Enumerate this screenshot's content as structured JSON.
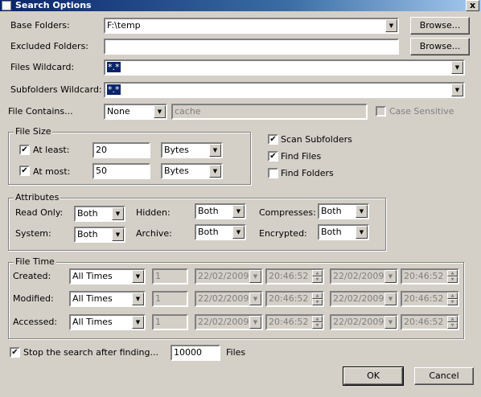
{
  "window": {
    "title": "Search Options",
    "close_glyph": "x"
  },
  "base_folders": {
    "label": "Base Folders:",
    "value": "F:\\temp",
    "browse": "Browse..."
  },
  "excluded_folders": {
    "label": "Excluded Folders:",
    "value": "",
    "browse": "Browse..."
  },
  "files_wildcard": {
    "label": "Files Wildcard:",
    "value": "*.*"
  },
  "subfolders_wildcard": {
    "label": "Subfolders Wildcard:",
    "value": "*.*"
  },
  "file_contains": {
    "label": "File Contains...",
    "mode": "None",
    "text": "cache",
    "case_sensitive": "Case Sensitive"
  },
  "file_size": {
    "title": "File Size",
    "at_least": {
      "label": "At least:",
      "value": "20",
      "unit": "Bytes",
      "checked": true
    },
    "at_most": {
      "label": "At most:",
      "value": "50",
      "unit": "Bytes",
      "checked": true
    }
  },
  "options": {
    "scan_subfolders": "Scan Subfolders",
    "find_files": "Find Files",
    "find_folders": "Find Folders"
  },
  "attributes": {
    "title": "Attributes",
    "read_only": {
      "label": "Read Only:",
      "value": "Both"
    },
    "hidden": {
      "label": "Hidden:",
      "value": "Both"
    },
    "compresses": {
      "label": "Compresses:",
      "value": "Both"
    },
    "system": {
      "label": "System:",
      "value": "Both"
    },
    "archive": {
      "label": "Archive:",
      "value": "Both"
    },
    "encrypted": {
      "label": "Encrypted:",
      "value": "Both"
    }
  },
  "file_time": {
    "title": "File Time",
    "rows": [
      {
        "label": "Created:",
        "mode": "All Times",
        "num": "1",
        "date1": "22/02/2009",
        "time1": "20:46:52",
        "date2": "22/02/2009",
        "time2": "20:46:52"
      },
      {
        "label": "Modified:",
        "mode": "All Times",
        "num": "1",
        "date1": "22/02/2009",
        "time1": "20:46:52",
        "date2": "22/02/2009",
        "time2": "20:46:52"
      },
      {
        "label": "Accessed:",
        "mode": "All Times",
        "num": "1",
        "date1": "22/02/2009",
        "time1": "20:46:52",
        "date2": "22/02/2009",
        "time2": "20:46:52"
      }
    ]
  },
  "stop_search": {
    "label": "Stop the search after finding...",
    "value": "10000",
    "unit": "Files"
  },
  "buttons": {
    "ok": "OK",
    "cancel": "Cancel"
  },
  "glyphs": {
    "check": "✔",
    "down": "▼",
    "up": "▲"
  }
}
